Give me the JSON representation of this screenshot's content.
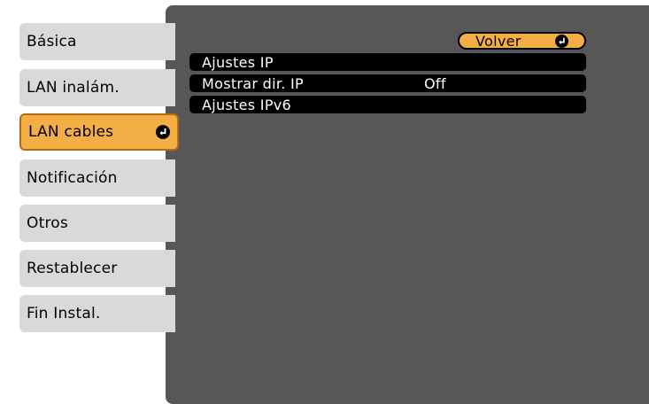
{
  "sidebar": {
    "items": [
      {
        "label": "Básica"
      },
      {
        "label": "LAN inalám."
      },
      {
        "label": "LAN cables",
        "selected": true
      },
      {
        "label": "Notificación"
      },
      {
        "label": "Otros"
      },
      {
        "label": "Restablecer"
      },
      {
        "label": "Fin Instal."
      }
    ]
  },
  "main": {
    "back_label": "Volver",
    "rows": [
      {
        "label": "Ajustes IP",
        "value": ""
      },
      {
        "label": "Mostrar dir. IP",
        "value": "Off"
      },
      {
        "label": "Ajustes IPv6",
        "value": ""
      }
    ]
  },
  "colors": {
    "panel": "#575757",
    "tab": "#d9d9d9",
    "accent": "#f3ae45",
    "row": "#000000"
  },
  "icons": {
    "enter": "enter-return-icon"
  }
}
